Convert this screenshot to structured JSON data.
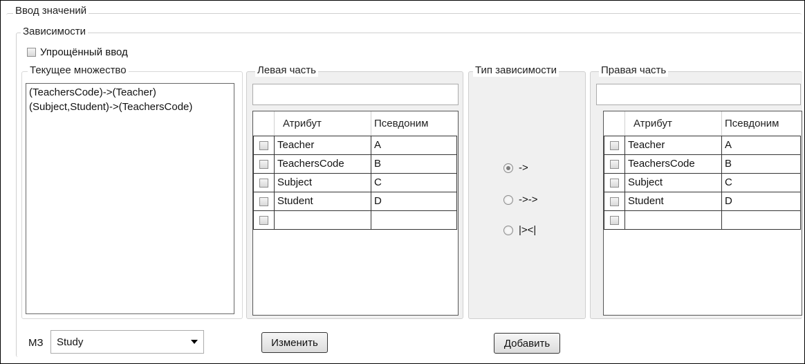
{
  "window": {
    "group_title": "Ввод значений"
  },
  "dependencies": {
    "title": "Зависимости",
    "simplified_input_label": "Упрощённый ввод",
    "simplified_input_checked": false
  },
  "current_set": {
    "title": "Текущее множество",
    "items": [
      "(TeachersCode)->(Teacher)",
      "(Subject,Student)->(TeachersCode)"
    ]
  },
  "left_part": {
    "title": "Левая часть",
    "input_value": "",
    "columns": [
      "Атрибут",
      "Псевдоним"
    ],
    "rows": [
      {
        "attribute": "Teacher",
        "alias": "A"
      },
      {
        "attribute": "TeachersCode",
        "alias": "B"
      },
      {
        "attribute": "Subject",
        "alias": "C"
      },
      {
        "attribute": "Student",
        "alias": "D"
      },
      {
        "attribute": "",
        "alias": ""
      }
    ]
  },
  "dependency_type": {
    "title": "Тип зависимости",
    "options": [
      {
        "label": "->",
        "checked": true
      },
      {
        "label": "->->",
        "checked": false
      },
      {
        "label": "|><|",
        "checked": false
      }
    ]
  },
  "right_part": {
    "title": "Правая часть",
    "input_value": "",
    "columns": [
      "Атрибут",
      "Псевдоним"
    ],
    "rows": [
      {
        "attribute": "Teacher",
        "alias": "A"
      },
      {
        "attribute": "TeachersCode",
        "alias": "B"
      },
      {
        "attribute": "Subject",
        "alias": "C"
      },
      {
        "attribute": "Student",
        "alias": "D"
      },
      {
        "attribute": "",
        "alias": ""
      }
    ]
  },
  "footer": {
    "mz_label": "МЗ",
    "mz_value": "Study",
    "change_button": "Изменить",
    "add_button": "Добавить"
  }
}
